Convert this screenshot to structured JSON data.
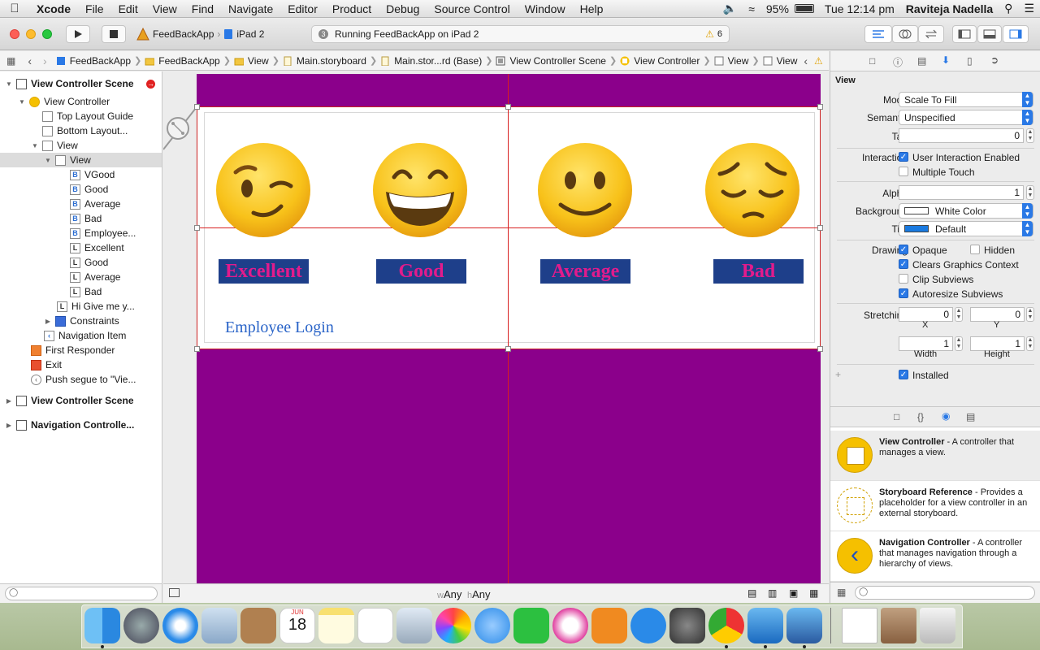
{
  "menubar": {
    "app": "Xcode",
    "items": [
      "File",
      "Edit",
      "View",
      "Find",
      "Navigate",
      "Editor",
      "Product",
      "Debug",
      "Source Control",
      "Window",
      "Help"
    ],
    "battery": "95%",
    "clock": "Tue 12:14 pm",
    "user": "Raviteja Nadella"
  },
  "toolbar": {
    "scheme_target": "FeedBackApp",
    "scheme_device": "iPad 2",
    "activity": "Running FeedBackApp on iPad 2",
    "activity_badge": "3",
    "warning_count": "6"
  },
  "jumpbar": {
    "crumbs": [
      "FeedBackApp",
      "FeedBackApp",
      "View",
      "Main.storyboard",
      "Main.stor...rd (Base)",
      "View Controller Scene",
      "View Controller",
      "View",
      "View"
    ]
  },
  "navigator": {
    "rows": [
      {
        "label": "View Controller Scene",
        "bold": true
      },
      {
        "label": "View Controller"
      },
      {
        "label": "Top Layout Guide"
      },
      {
        "label": "Bottom Layout..."
      },
      {
        "label": "View"
      },
      {
        "label": "View"
      },
      {
        "label": "VGood",
        "badge": "B"
      },
      {
        "label": "Good",
        "badge": "B"
      },
      {
        "label": "Average",
        "badge": "B"
      },
      {
        "label": "Bad",
        "badge": "B"
      },
      {
        "label": "Employee...",
        "badge": "B"
      },
      {
        "label": "Excellent",
        "badge": "L"
      },
      {
        "label": "Good",
        "badge": "L"
      },
      {
        "label": "Average",
        "badge": "L"
      },
      {
        "label": "Bad",
        "badge": "L"
      },
      {
        "label": "Hi Give me y...",
        "badge": "L"
      },
      {
        "label": "Constraints"
      },
      {
        "label": "Navigation Item"
      },
      {
        "label": "First Responder"
      },
      {
        "label": "Exit"
      },
      {
        "label": "Push segue to \"Vie..."
      },
      {
        "label": "View Controller Scene",
        "bold": true
      },
      {
        "label": "Navigation Controlle...",
        "bold": true
      }
    ]
  },
  "canvas": {
    "labels": [
      "Excellent",
      "Good",
      "Average",
      "Bad"
    ],
    "login": "Employee Login",
    "size_w_prefix": "w",
    "size_w": "Any",
    "size_h_prefix": "h",
    "size_h": "Any",
    "scene_color": "#8b008b",
    "label_bg": "#1e3f8a",
    "label_fg": "#e21b8c"
  },
  "inspector": {
    "section": "View",
    "mode_label": "Mode",
    "mode": "Scale To Fill",
    "semantic_label": "Semantic",
    "semantic": "Unspecified",
    "tag_label": "Tag",
    "tag": "0",
    "interaction_label": "Interaction",
    "user_interaction": "User Interaction Enabled",
    "multiple_touch": "Multiple Touch",
    "alpha_label": "Alpha",
    "alpha": "1",
    "background_label": "Background",
    "background": "White Color",
    "tint_label": "Tint",
    "tint": "Default",
    "drawing_label": "Drawing",
    "opaque": "Opaque",
    "hidden": "Hidden",
    "clears": "Clears Graphics Context",
    "clip": "Clip Subviews",
    "autoresize": "Autoresize Subviews",
    "stretching_label": "Stretching",
    "stretch_x": "0",
    "stretch_y": "0",
    "x_label": "X",
    "y_label": "Y",
    "stretch_w": "1",
    "stretch_h": "1",
    "width_label": "Width",
    "height_label": "Height",
    "installed": "Installed"
  },
  "library": {
    "items": [
      {
        "title": "View Controller",
        "desc": " - A controller that manages a view."
      },
      {
        "title": "Storyboard Reference",
        "desc": " - Provides a placeholder for a view controller in an external storyboard."
      },
      {
        "title": "Navigation Controller",
        "desc": " - A controller that manages navigation through a hierarchy of views."
      }
    ]
  },
  "dock": {
    "calendar_month": "JUN",
    "calendar_day": "18"
  }
}
